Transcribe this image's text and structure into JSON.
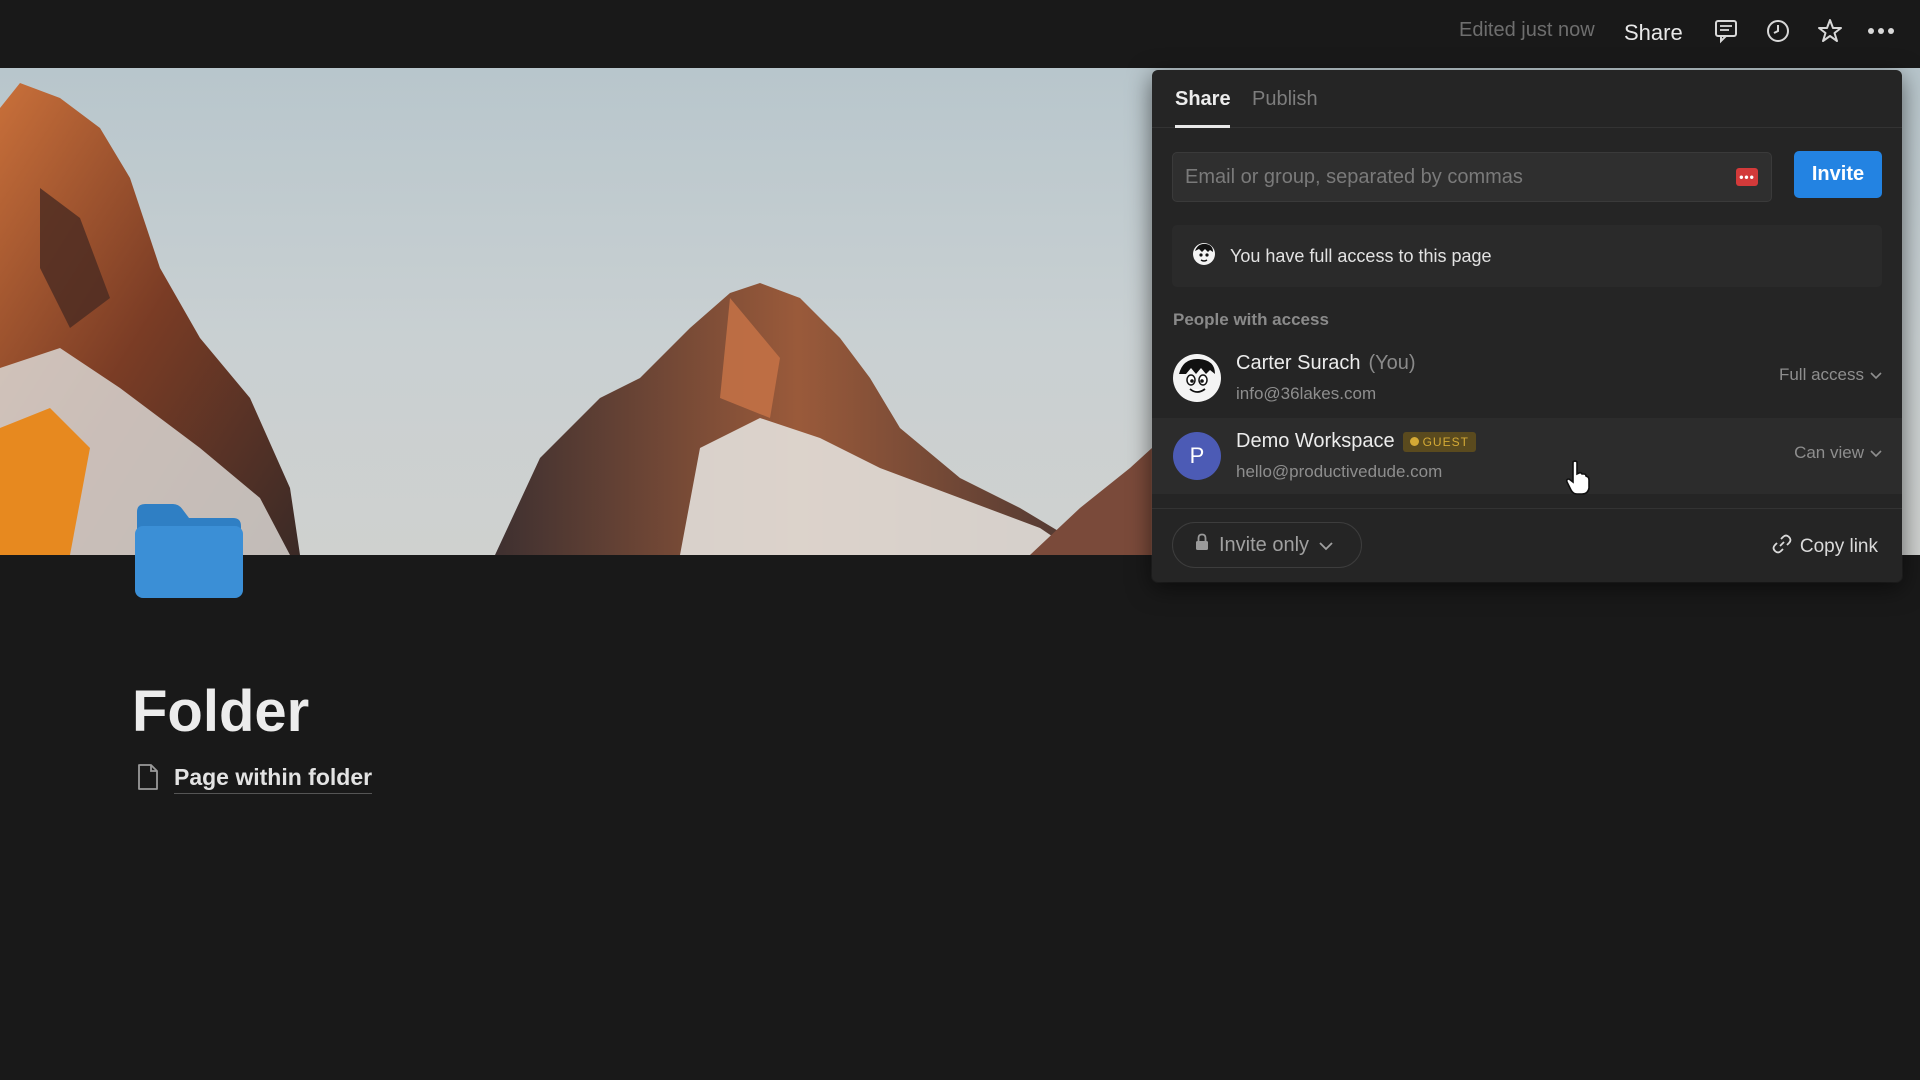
{
  "topbar": {
    "edited_status": "Edited just now",
    "share_label": "Share",
    "icons": [
      "comment-icon",
      "history-clock-icon",
      "star-icon",
      "more-icon"
    ]
  },
  "page": {
    "title": "Folder",
    "icon": "folder-icon",
    "subpage_label": "Page within folder",
    "subpage_icon": "document-icon"
  },
  "share_panel": {
    "tabs": [
      {
        "label": "Share",
        "active": true
      },
      {
        "label": "Publish",
        "active": false
      }
    ],
    "input_placeholder": "Email or group, separated by commas",
    "invite_label": "Invite",
    "access_note": "You have full access to this page",
    "section_label": "People with access",
    "people": [
      {
        "name": "Carter Surach",
        "suffix": "(You)",
        "email": "info@36lakes.com",
        "permission": "Full access",
        "avatar": "cartoon-avatar"
      },
      {
        "name": "Demo Workspace",
        "badge": "GUEST",
        "email": "hello@productivedude.com",
        "permission": "Can view",
        "avatar_letter": "P"
      }
    ],
    "general_access": "Invite only",
    "copy_link_label": "Copy link"
  },
  "colors": {
    "background": "#191919",
    "panel": "#252525",
    "accent": "#2383e2",
    "folder_blue": "#3b8fd6",
    "guest_badge": "#d4a935"
  }
}
